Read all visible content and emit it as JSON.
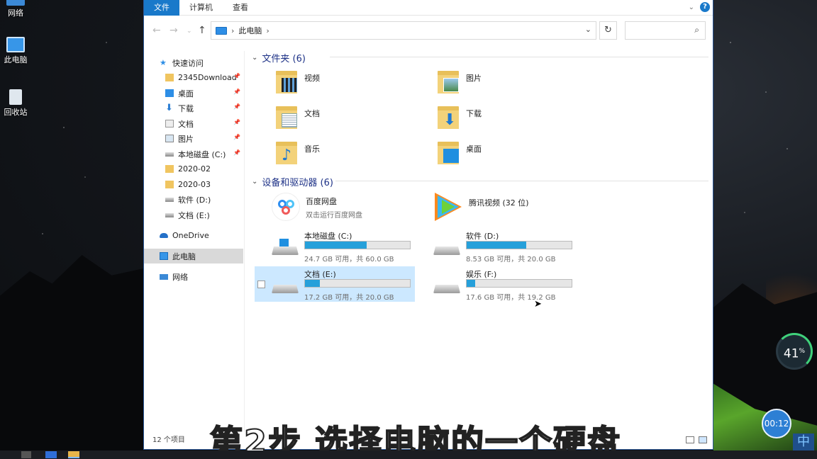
{
  "desktop": {
    "icons": [
      {
        "label": "网络",
        "icon": "network-icon"
      },
      {
        "label": "此电脑",
        "icon": "computer-icon"
      },
      {
        "label": "回收站",
        "icon": "recycle-bin-icon"
      }
    ]
  },
  "ribbon": {
    "tabs": [
      "文件",
      "计算机",
      "查看"
    ],
    "active_tab": "文件",
    "accent": "#1979ca"
  },
  "address": {
    "path": "此电脑",
    "sep": "›"
  },
  "nav": {
    "quick_access": "快速访问",
    "quick_items": [
      {
        "label": "2345Download",
        "pinned": true
      },
      {
        "label": "桌面",
        "pinned": true
      },
      {
        "label": "下载",
        "pinned": true
      },
      {
        "label": "文档",
        "pinned": true
      },
      {
        "label": "图片",
        "pinned": true
      },
      {
        "label": "本地磁盘 (C:)",
        "pinned": true
      },
      {
        "label": "2020-02",
        "pinned": false
      },
      {
        "label": "2020-03",
        "pinned": false
      },
      {
        "label": "软件 (D:)",
        "pinned": false
      },
      {
        "label": "文档 (E:)",
        "pinned": false
      }
    ],
    "onedrive": "OneDrive",
    "this_pc": "此电脑",
    "network": "网络"
  },
  "folders": {
    "header": "文件夹 (6)",
    "items": [
      "视频",
      "图片",
      "文档",
      "下载",
      "音乐",
      "桌面"
    ]
  },
  "devices": {
    "header": "设备和驱动器 (6)",
    "baidu": {
      "name": "百度网盘",
      "sub": "双击运行百度网盘"
    },
    "tencent": {
      "name": "腾讯视频 (32 位)"
    },
    "drives": [
      {
        "name": "本地磁盘 (C:)",
        "free": "24.7 GB 可用，共 60.0 GB",
        "used_fraction": 0.59
      },
      {
        "name": "软件 (D:)",
        "free": "8.53 GB 可用，共 20.0 GB",
        "used_fraction": 0.57
      },
      {
        "name": "文档 (E:)",
        "free": "17.2 GB 可用，共 20.0 GB",
        "used_fraction": 0.14
      },
      {
        "name": "娱乐 (F:)",
        "free": "17.6 GB 可用，共 19.2 GB",
        "used_fraction": 0.08
      }
    ]
  },
  "status": {
    "count": "12 个项目"
  },
  "overlay": {
    "caption": "第2步  选择电脑的一个硬盘",
    "gauge_value": "41",
    "gauge_unit": "%",
    "timer": "00:12",
    "ime": "中"
  }
}
